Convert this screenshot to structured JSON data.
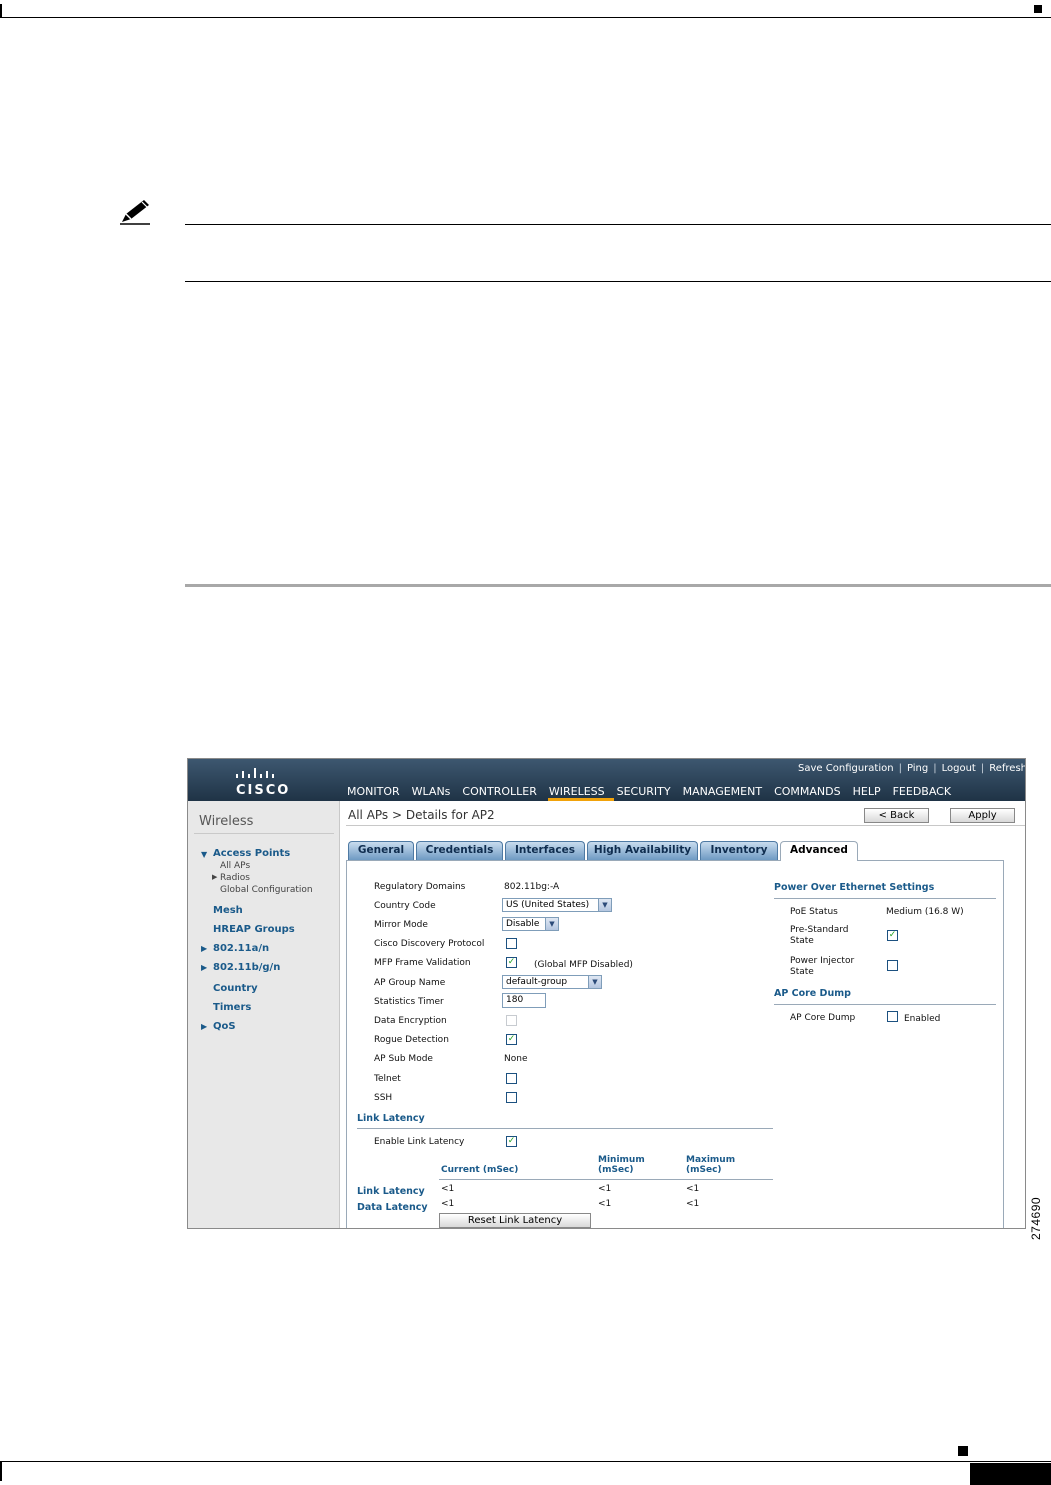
{
  "figure": {
    "id": "274690"
  },
  "screenshot": {
    "logo": "CISCO",
    "utility_links": [
      "Save Configuration",
      "Ping",
      "Logout",
      "Refresh"
    ],
    "menu": [
      "MONITOR",
      "WLANs",
      "CONTROLLER",
      "WIRELESS",
      "SECURITY",
      "MANAGEMENT",
      "COMMANDS",
      "HELP",
      "FEEDBACK"
    ],
    "active_menu": "WIRELESS",
    "sidebar": {
      "title": "Wireless",
      "access_points": "Access Points",
      "ap_subitems": [
        "All APs",
        "Radios",
        "Global Configuration"
      ],
      "items": [
        "Mesh",
        "HREAP Groups",
        "802.11a/n",
        "802.11b/g/n",
        "Country",
        "Timers",
        "QoS"
      ]
    },
    "page_title": "All APs > Details for AP2",
    "buttons": {
      "back": "< Back",
      "apply": "Apply",
      "reset_link_latency": "Reset Link Latency"
    },
    "tabs": [
      "General",
      "Credentials",
      "Interfaces",
      "High Availability",
      "Inventory",
      "Advanced"
    ],
    "active_tab": "Advanced",
    "left_fields": {
      "regulatory_domains": {
        "label": "Regulatory Domains",
        "value": "802.11bg:-A"
      },
      "country_code": {
        "label": "Country Code",
        "value": "US (United States)"
      },
      "mirror_mode": {
        "label": "Mirror Mode",
        "value": "Disable"
      },
      "cdp": {
        "label": "Cisco Discovery Protocol",
        "checked": false
      },
      "mfp": {
        "label": "MFP Frame Validation",
        "checked": true,
        "note": "(Global MFP Disabled)"
      },
      "ap_group": {
        "label": "AP Group Name",
        "value": "default-group"
      },
      "stats_timer": {
        "label": "Statistics Timer",
        "value": "180"
      },
      "data_encryption": {
        "label": "Data Encryption",
        "checked": false
      },
      "rogue_detection": {
        "label": "Rogue Detection",
        "checked": true
      },
      "ap_sub_mode": {
        "label": "AP Sub Mode",
        "value": "None"
      },
      "telnet": {
        "label": "Telnet",
        "checked": false
      },
      "ssh": {
        "label": "SSH",
        "checked": false
      }
    },
    "link_latency": {
      "section": "Link Latency",
      "enable_label": "Enable Link Latency",
      "enabled": true,
      "columns": [
        "Current (mSec)",
        "Minimum (mSec)",
        "Maximum (mSec)"
      ],
      "rows": [
        {
          "label": "Link Latency",
          "current": "<1",
          "minimum": "<1",
          "maximum": "<1"
        },
        {
          "label": "Data Latency",
          "current": "<1",
          "minimum": "<1",
          "maximum": "<1"
        }
      ]
    },
    "poe": {
      "section": "Power Over Ethernet Settings",
      "status_label": "PoE Status",
      "status_value": "Medium (16.8 W)",
      "pre_standard_label": "Pre-Standard State",
      "pre_standard_checked": true,
      "injector_label": "Power Injector State",
      "injector_checked": false
    },
    "core_dump": {
      "section": "AP Core Dump",
      "label": "AP Core Dump",
      "checked": false,
      "enabled_text": "Enabled"
    }
  }
}
